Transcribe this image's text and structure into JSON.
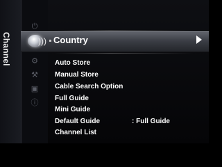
{
  "side_tab": {
    "label": "Channel"
  },
  "icons": [
    "power-icon",
    "channel-antenna-icon",
    "gear-icon",
    "tools-icon",
    "picture-icon",
    "help-icon"
  ],
  "selected": {
    "label": "Country"
  },
  "menu": {
    "items": [
      {
        "label": "Auto Store"
      },
      {
        "label": "Manual Store"
      },
      {
        "label": "Cable Search Option"
      },
      {
        "label": "Full Guide"
      },
      {
        "label": "Mini Guide"
      },
      {
        "label": "Default Guide",
        "value": ": Full Guide"
      },
      {
        "label": "Channel List"
      }
    ]
  },
  "colors": {
    "highlight": "#4a4d55",
    "background": "#0a0b0e",
    "text": "#ffffff"
  }
}
